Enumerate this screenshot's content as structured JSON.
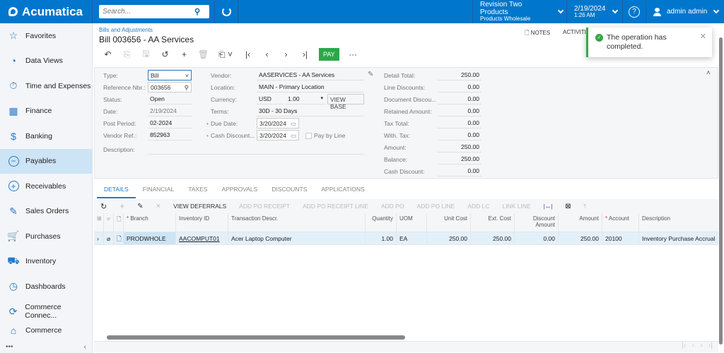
{
  "app": {
    "name": "Acumatica"
  },
  "topbar": {
    "search_placeholder": "Search...",
    "company": "Revision Two Products",
    "branch": "Products Wholesale",
    "date": "2/19/2024",
    "time": "1:26 AM",
    "help": "?",
    "user": "admin admin"
  },
  "sidebar": {
    "items": [
      {
        "label": "Favorites",
        "icon": "☆"
      },
      {
        "label": "Data Views",
        "icon": "◔"
      },
      {
        "label": "Time and Expenses",
        "icon": "⏱"
      },
      {
        "label": "Finance",
        "icon": "▦"
      },
      {
        "label": "Banking",
        "icon": "$"
      },
      {
        "label": "Payables",
        "icon": "−"
      },
      {
        "label": "Receivables",
        "icon": "+"
      },
      {
        "label": "Sales Orders",
        "icon": "✎"
      },
      {
        "label": "Purchases",
        "icon": "🛒"
      },
      {
        "label": "Inventory",
        "icon": "⛟"
      },
      {
        "label": "Dashboards",
        "icon": "◷"
      },
      {
        "label": "Commerce Connec...",
        "icon": "⟳"
      },
      {
        "label": "Commerce",
        "icon": "⌂"
      }
    ],
    "more": "•••",
    "collapse": "‹"
  },
  "page": {
    "breadcrumb": "Bills and Adjustments",
    "title": "Bill 003656 - AA Services",
    "notes": "NOTES",
    "activities": "ACTIVITIES",
    "pay_label": "PAY",
    "more": "···"
  },
  "form": {
    "type_label": "Type:",
    "type_value": "Bill",
    "ref_label": "Reference Nbr.:",
    "ref_value": "003656",
    "status_label": "Status:",
    "status_value": "Open",
    "date_label": "Date:",
    "date_value": "2/19/2024",
    "period_label": "Post Period:",
    "period_value": "02-2024",
    "vendref_label": "Vendor Ref.:",
    "vendref_value": "852963",
    "desc_label": "Description:",
    "desc_value": "",
    "vendor_label": "Vendor:",
    "vendor_value": "AASERVICES - AA Services",
    "location_label": "Location:",
    "location_value": "MAIN - Primary Location",
    "currency_label": "Currency:",
    "currency_value": "USD",
    "rate_value": "1.00",
    "view_base": "VIEW BASE",
    "terms_label": "Terms:",
    "terms_value": "30D - 30 Days",
    "due_label": "Due Date:",
    "due_value": "3/20/2024",
    "cashdisc_label": "Cash Discount...",
    "cashdisc_value": "3/20/2024",
    "paybyline_label": "Pay by Line",
    "totals": [
      {
        "label": "Detail Total:",
        "value": "250.00"
      },
      {
        "label": "Line Discounts:",
        "value": "0.00"
      },
      {
        "label": "Document Discou...",
        "value": "0.00"
      },
      {
        "label": "Retained Amount:",
        "value": "0.00"
      },
      {
        "label": "Tax Total:",
        "value": "0.00"
      },
      {
        "label": "With. Tax:",
        "value": "0.00"
      },
      {
        "label": "Amount:",
        "value": "250.00"
      },
      {
        "label": "Balance:",
        "value": "250.00"
      },
      {
        "label": "Cash Discount:",
        "value": "0.00"
      }
    ]
  },
  "tabs": [
    "DETAILS",
    "FINANCIAL",
    "TAXES",
    "APPROVALS",
    "DISCOUNTS",
    "APPLICATIONS"
  ],
  "grid_toolbar": {
    "view_deferrals": "VIEW DEFERRALS",
    "add_po_receipt": "ADD PO RECEIPT",
    "add_po_receipt_line": "ADD PO RECEIPT LINE",
    "add_po": "ADD PO",
    "add_po_line": "ADD PO LINE",
    "add_lc": "ADD LC",
    "link_line": "LINK LINE"
  },
  "grid": {
    "columns": [
      "Branch",
      "Inventory ID",
      "Transaction Descr.",
      "Quantity",
      "UOM",
      "Unit Cost",
      "Ext. Cost",
      "Discount Amount",
      "Amount",
      "Account",
      "Description"
    ],
    "rows": [
      {
        "branch": "PRODWHOLE",
        "inventory_id": "AACOMPUT01",
        "descr": "Acer Laptop Computer",
        "quantity": "1.00",
        "uom": "EA",
        "unit_cost": "250.00",
        "ext_cost": "250.00",
        "discount": "0.00",
        "amount": "250.00",
        "account": "20100",
        "description": "Inventory Purchase Accrual"
      }
    ]
  },
  "toast": {
    "message": "The operation has completed."
  }
}
